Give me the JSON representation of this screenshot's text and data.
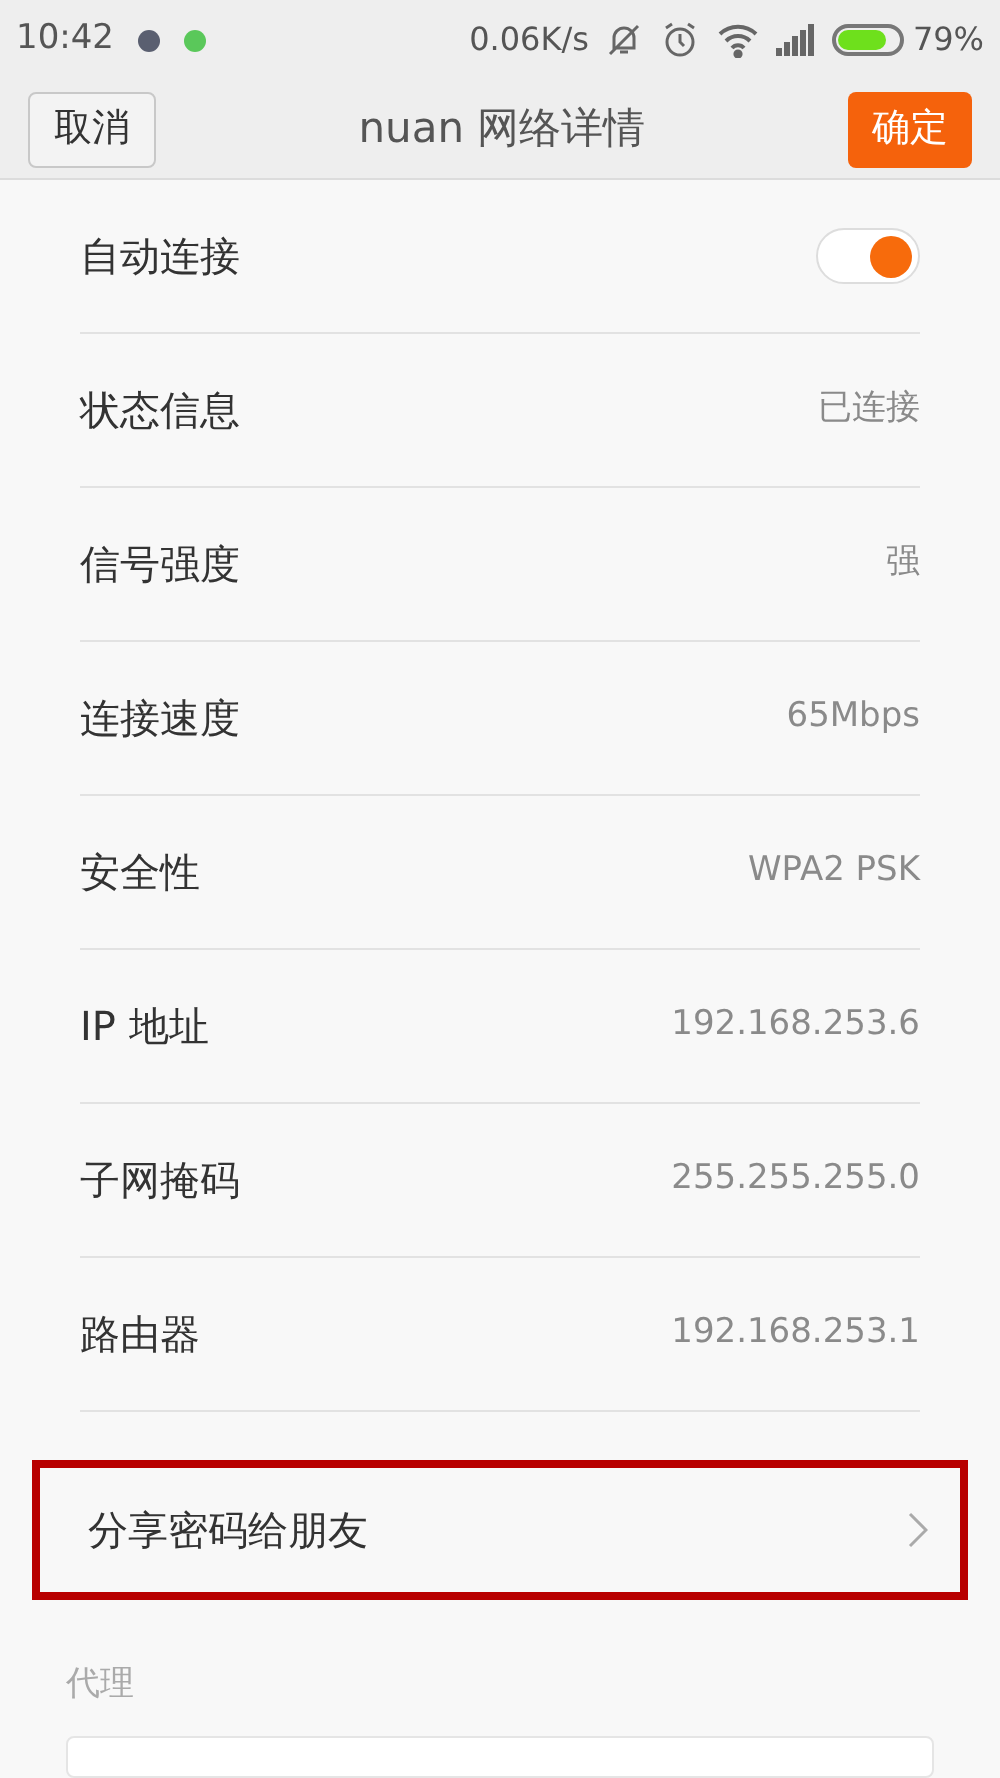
{
  "status_bar": {
    "time": "10:42",
    "speed": "0.06K/s",
    "battery": "79%"
  },
  "header": {
    "cancel": "取消",
    "title": "nuan 网络详情",
    "confirm": "确定"
  },
  "rows": [
    {
      "kind": "toggle",
      "label": "自动连接",
      "on": true
    },
    {
      "kind": "value",
      "label": "状态信息",
      "value": "已连接"
    },
    {
      "kind": "value",
      "label": "信号强度",
      "value": "强"
    },
    {
      "kind": "value",
      "label": "连接速度",
      "value": "65Mbps"
    },
    {
      "kind": "value",
      "label": "安全性",
      "value": "WPA2 PSK"
    },
    {
      "kind": "value",
      "label": "IP 地址",
      "value": "192.168.253.6"
    },
    {
      "kind": "value",
      "label": "子网掩码",
      "value": "255.255.255.0"
    },
    {
      "kind": "value",
      "label": "路由器",
      "value": "192.168.253.1"
    }
  ],
  "share": {
    "label": "分享密码给朋友",
    "highlighted": true
  },
  "proxy": {
    "label": "代理"
  }
}
